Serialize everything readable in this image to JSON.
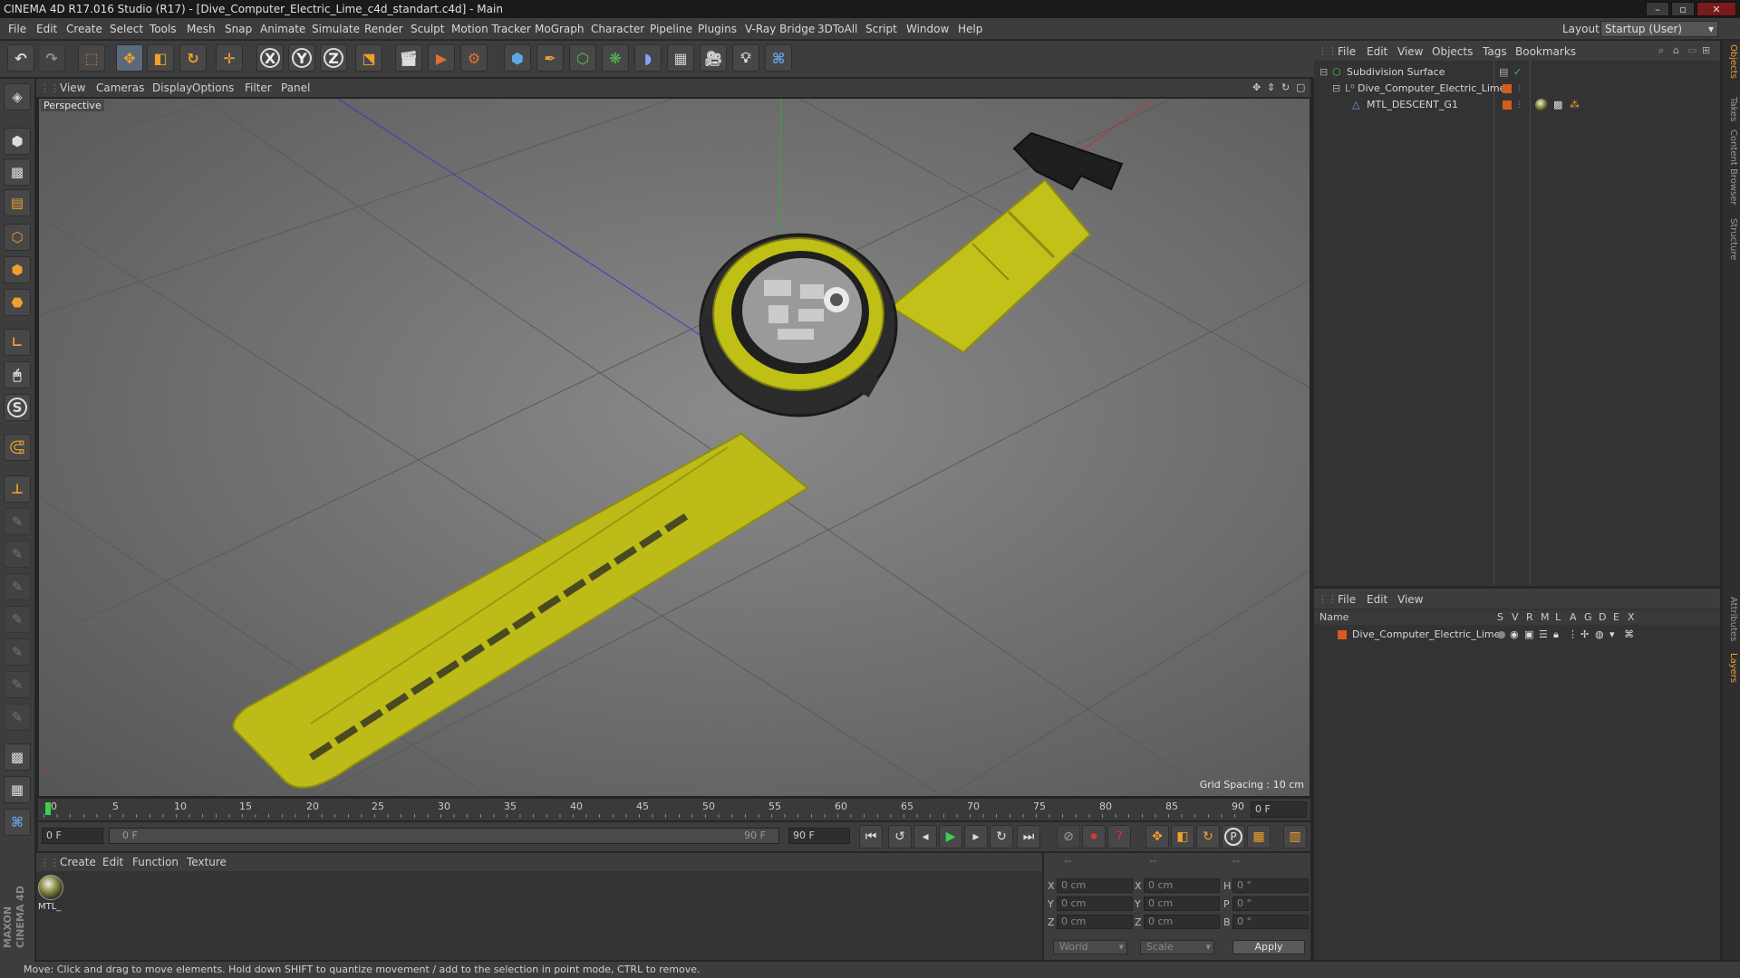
{
  "window": {
    "title": "CINEMA 4D R17.016 Studio (R17) - [Dive_Computer_Electric_Lime_c4d_standart.c4d] - Main",
    "minimize": "–",
    "maximize": "▫",
    "close": "✕"
  },
  "menubar": {
    "items": [
      "File",
      "Edit",
      "Create",
      "Select",
      "Tools",
      "Mesh",
      "Snap",
      "Animate",
      "Simulate",
      "Render",
      "Sculpt",
      "Motion Tracker",
      "MoGraph",
      "Character",
      "Pipeline",
      "Plugins",
      "V-Ray Bridge",
      "3DToAll",
      "Script",
      "Window",
      "Help"
    ],
    "layout_label": "Layout:",
    "layout_value": "Startup (User)"
  },
  "toolbar": {
    "x_label": "X",
    "y_label": "Y",
    "z_label": "Z"
  },
  "viewport": {
    "menu": [
      "View",
      "Cameras",
      "Display",
      "Options",
      "Filter",
      "Panel"
    ],
    "label": "Perspective",
    "grid_spacing": "Grid Spacing : 10 cm",
    "colors": {
      "strap": "#c7c51a",
      "bezel": "#bfbf16",
      "case": "#2c2c2c",
      "axis_x": "#c93030",
      "axis_y": "#2fb02f",
      "axis_z": "#3a3ad0"
    }
  },
  "timeline": {
    "ticks": [
      "0",
      "5",
      "10",
      "15",
      "20",
      "25",
      "30",
      "35",
      "40",
      "45",
      "50",
      "55",
      "60",
      "65",
      "70",
      "75",
      "80",
      "85",
      "90"
    ],
    "current_frame": "0 F"
  },
  "playbar": {
    "start": "0 F",
    "range_start": "0 F",
    "range_end": "90 F",
    "end": "90 F"
  },
  "materials": {
    "menu": [
      "Create",
      "Edit",
      "Function",
      "Texture"
    ],
    "items": [
      {
        "name": "MTL_"
      }
    ]
  },
  "coordinates": {
    "header": [
      "--",
      "--",
      "--"
    ],
    "rows": [
      {
        "l1": "X",
        "v1": "0 cm",
        "l2": "X",
        "v2": "0 cm",
        "l3": "H",
        "v3": "0 °"
      },
      {
        "l1": "Y",
        "v1": "0 cm",
        "l2": "Y",
        "v2": "0 cm",
        "l3": "P",
        "v3": "0 °"
      },
      {
        "l1": "Z",
        "v1": "0 cm",
        "l2": "Z",
        "v2": "0 cm",
        "l3": "B",
        "v3": "0 °"
      }
    ],
    "mode": "World",
    "scale": "Scale",
    "apply": "Apply"
  },
  "objects_panel": {
    "menu": [
      "File",
      "Edit",
      "View",
      "Objects",
      "Tags",
      "Bookmarks"
    ],
    "tree": [
      {
        "name": "Subdivision Surface",
        "indent": 0
      },
      {
        "name": "Dive_Computer_Electric_Lime",
        "indent": 1
      },
      {
        "name": "MTL_DESCENT_G1",
        "indent": 2
      }
    ]
  },
  "layers_panel": {
    "menu": [
      "File",
      "Edit",
      "View"
    ],
    "header": {
      "name": "Name",
      "cols": [
        "S",
        "V",
        "R",
        "M",
        "L",
        "A",
        "G",
        "D",
        "E",
        "X"
      ]
    },
    "rows": [
      {
        "name": "Dive_Computer_Electric_Lime"
      }
    ]
  },
  "right_tabs": [
    "Objects",
    "Takes",
    "Content Browser",
    "Structure",
    "Attributes",
    "Layers"
  ],
  "status": "Move: Click and drag to move elements. Hold down SHIFT to quantize movement / add to the selection in point mode, CTRL to remove.",
  "brand": "MAXON CINEMA 4D"
}
